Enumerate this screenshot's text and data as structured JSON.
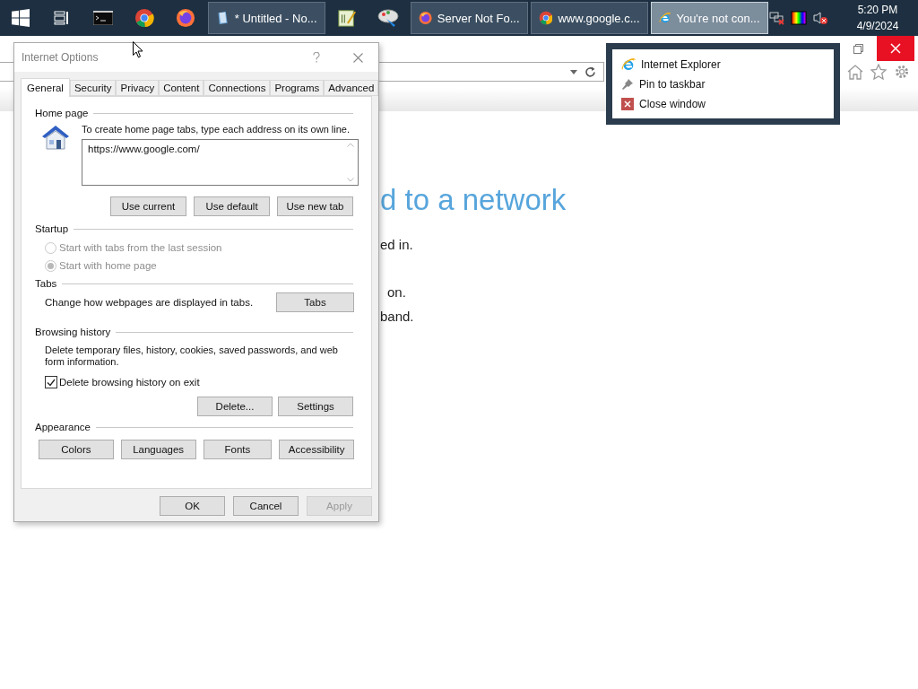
{
  "taskbar": {
    "items": [
      {
        "kind": "start",
        "selected": false
      },
      {
        "kind": "taskview",
        "selected": false
      },
      {
        "kind": "terminal",
        "selected": false
      },
      {
        "kind": "chrome",
        "selected": false
      },
      {
        "kind": "firefox",
        "selected": false
      },
      {
        "kind": "notepad",
        "label": "* Untitled - No...",
        "selected": false
      },
      {
        "kind": "editor",
        "selected": false
      },
      {
        "kind": "paint",
        "selected": false
      },
      {
        "kind": "firefox",
        "label": "Server Not Fo...",
        "selected": false
      },
      {
        "kind": "chrome",
        "label": "www.google.c...",
        "selected": false
      },
      {
        "kind": "ie",
        "label": "You're not con...",
        "selected": true
      }
    ],
    "tray": {
      "time": "5:20 PM",
      "date": "4/9/2024"
    }
  },
  "jump_list": {
    "items": [
      {
        "kind": "ie",
        "label": "Internet Explorer"
      },
      {
        "kind": "pin",
        "label": "Pin to taskbar"
      },
      {
        "kind": "close",
        "label": "Close window"
      }
    ]
  },
  "browser": {
    "heading": "d to a network",
    "lines": [
      "ed in.",
      "on.",
      "band."
    ]
  },
  "dialog": {
    "title": "Internet Options",
    "tabs": [
      {
        "label": "General",
        "selected": true
      },
      {
        "label": "Security",
        "selected": false
      },
      {
        "label": "Privacy",
        "selected": false
      },
      {
        "label": "Content",
        "selected": false
      },
      {
        "label": "Connections",
        "selected": false
      },
      {
        "label": "Programs",
        "selected": false
      },
      {
        "label": "Advanced",
        "selected": false
      }
    ],
    "home_page": {
      "legend": "Home page",
      "hint": "To create home page tabs, type each address on its own line.",
      "value": "https://www.google.com/",
      "buttons": [
        "Use current",
        "Use default",
        "Use new tab"
      ]
    },
    "startup": {
      "legend": "Startup",
      "options": [
        {
          "label": "Start with tabs from the last session",
          "selected": false,
          "disabled": true
        },
        {
          "label": "Start with home page",
          "selected": true,
          "disabled": true
        }
      ]
    },
    "tabs_section": {
      "legend": "Tabs",
      "text": "Change how webpages are displayed in tabs.",
      "button": "Tabs"
    },
    "history": {
      "legend": "Browsing history",
      "text": "Delete temporary files, history, cookies, saved passwords, and web form information.",
      "checkbox": {
        "label": "Delete browsing history on exit",
        "checked": true
      },
      "buttons": [
        "Delete...",
        "Settings"
      ]
    },
    "appearance": {
      "legend": "Appearance",
      "buttons": [
        "Colors",
        "Languages",
        "Fonts",
        "Accessibility"
      ]
    },
    "footer": [
      {
        "label": "OK",
        "disabled": false
      },
      {
        "label": "Cancel",
        "disabled": false
      },
      {
        "label": "Apply",
        "disabled": true
      }
    ]
  }
}
